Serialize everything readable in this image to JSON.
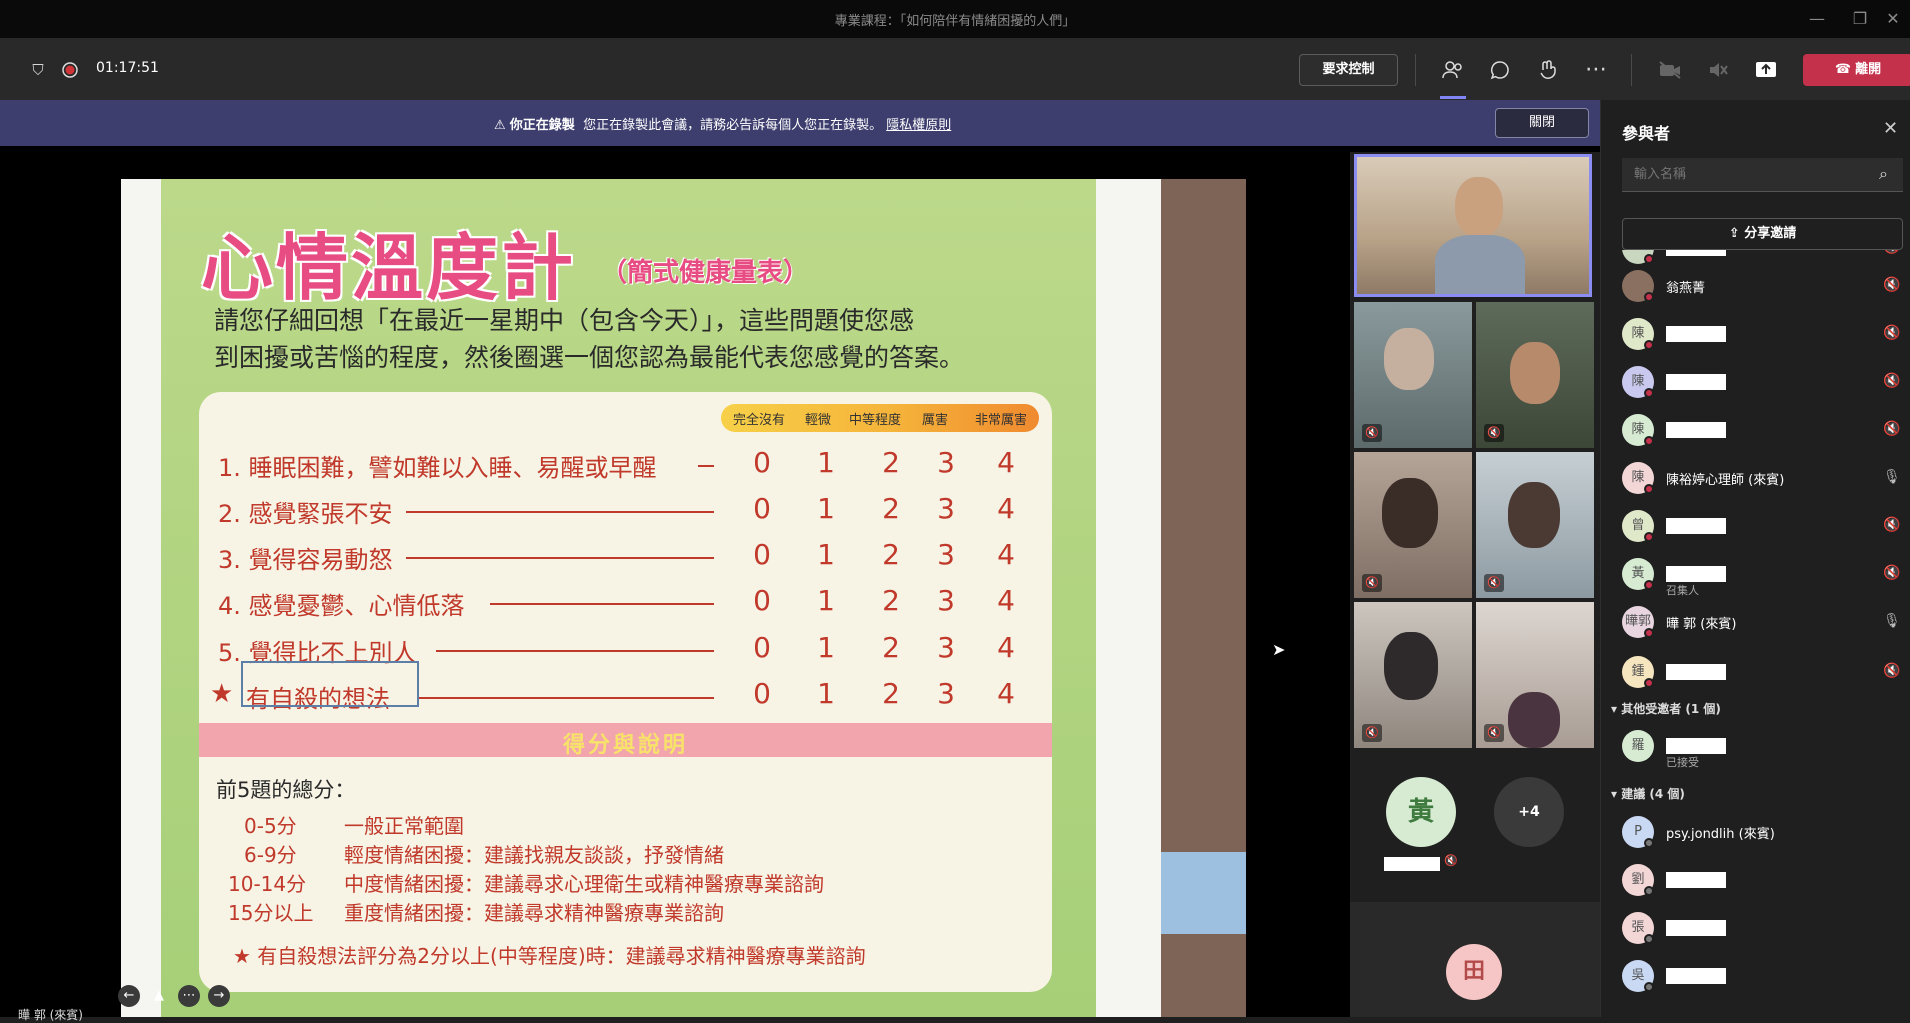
{
  "window": {
    "title": "專業課程：「如何陪伴有情緒困擾的人們」",
    "minimize_icon": "—",
    "restore_icon": "❐",
    "close_icon": "✕"
  },
  "toolbar": {
    "timer": "01:17:51",
    "request_control": "要求控制",
    "leave": "離開"
  },
  "recording_bar": {
    "bold_text": "你正在錄製",
    "message": "您正在錄製此會議，請務必告訴每個人您正在錄製。",
    "privacy_link": "隱私權原則",
    "dismiss": "關閉"
  },
  "slide": {
    "title": "心情溫度計",
    "subtitle": "（簡式健康量表）",
    "intro_line1": "請您仔細回想「在最近一星期中（包含今天）」，這些問題使您感",
    "intro_line2": "到困擾或苦惱的程度，然後圈選一個您認為最能代表您感覺的答案。",
    "scale_headers": [
      "完全沒有",
      "輕微",
      "中等程度",
      "厲害",
      "非常厲害"
    ],
    "questions": [
      "1. 睡眠困難，譬如難以入睡、易醒或早醒",
      "2. 感覺緊張不安",
      "3. 覺得容易動怒",
      "4. 感覺憂鬱、心情低落",
      "5. 覺得比不上別人",
      "有自殺的想法"
    ],
    "star": "★",
    "scores": [
      "0",
      "1",
      "2",
      "3",
      "4"
    ],
    "score_banner": "得分與說明",
    "sum_title": "前5題的總分：",
    "ranges": [
      {
        "range": "0-5分",
        "desc": "一般正常範圍"
      },
      {
        "range": "6-9分",
        "desc": "輕度情緒困擾：建議找親友談談，抒發情緒"
      },
      {
        "range": "10-14分",
        "desc": "中度情緒困擾：建議尋求心理衛生或精神醫療專業諮詢"
      },
      {
        "range": "15分以上",
        "desc": "重度情緒困擾：建議尋求精神醫療專業諮詢"
      }
    ],
    "note": "★ 有自殺想法評分為2分以上(中等程度)時：建議尋求精神醫療專業諮詢"
  },
  "presenter_label": "曄 郭 (來賓)",
  "gallery": {
    "avatar_initial": "黃",
    "more_count": "+4",
    "bottom_avatar": "田"
  },
  "participants_panel": {
    "title": "參與者",
    "search_placeholder": "輸入名稱",
    "share_invite": "分享邀請",
    "section_others": "其他受邀者 (1 個)",
    "section_suggestions": "建議 (4 個)",
    "accepted": "已接受",
    "organizer": "召集人",
    "people": [
      {
        "initial": "",
        "name": "",
        "color": "#c9d7c0"
      },
      {
        "initial": "",
        "name": "翁燕菁",
        "color": "#8a7060"
      },
      {
        "initial": "陳",
        "name": "",
        "color": "#dfe8c9"
      },
      {
        "initial": "陳",
        "name": "",
        "color": "#c9c9ef"
      },
      {
        "initial": "陳",
        "name": "",
        "color": "#d6ebd2"
      },
      {
        "initial": "陳",
        "name": "陳裕婷心理師 (來賓)",
        "color": "#f3d6d6"
      },
      {
        "initial": "曾",
        "name": "",
        "color": "#dfe8c9"
      },
      {
        "initial": "黃",
        "name": "",
        "color": "#d6ebd2"
      },
      {
        "initial": "曄郭",
        "name": "曄 郭 (來賓)",
        "color": "#e8d5e0"
      },
      {
        "initial": "鍾",
        "name": "",
        "color": "#f6e6c0"
      }
    ],
    "other_invitee": {
      "initial": "羅",
      "color": "#d6ebd2"
    },
    "suggestions": [
      {
        "initial": "P",
        "name": "psy.jondlih (來賓)",
        "color": "#c9d9f3"
      },
      {
        "initial": "劉",
        "name": "",
        "color": "#f3d6d6"
      },
      {
        "initial": "張",
        "name": "",
        "color": "#f3d6d6"
      },
      {
        "initial": "吳",
        "name": "",
        "color": "#c9d9f3"
      }
    ]
  }
}
